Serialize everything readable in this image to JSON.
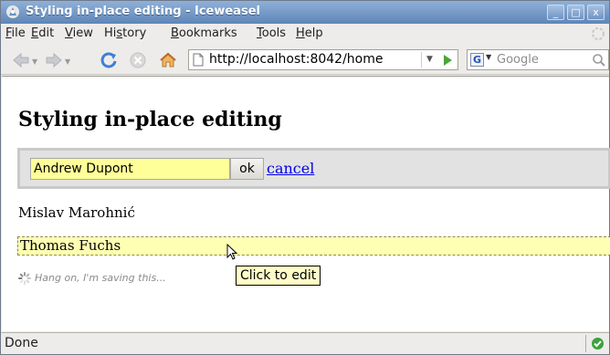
{
  "window": {
    "title": "Styling in-place editing - Iceweasel",
    "controls": {
      "minimize": "_",
      "maximize": "□",
      "close": "x"
    }
  },
  "menu": [
    {
      "accel": "F",
      "rest": "ile"
    },
    {
      "accel": "E",
      "rest": "dit"
    },
    {
      "accel": "V",
      "rest": "iew"
    },
    {
      "pre": "Hi",
      "accel": "s",
      "rest": "tory"
    },
    {
      "accel": "B",
      "rest": "ookmarks"
    },
    {
      "accel": "T",
      "rest": "ools"
    },
    {
      "accel": "H",
      "rest": "elp"
    }
  ],
  "navigation": {
    "url": "http://localhost:8042/home",
    "search_placeholder": "Google",
    "search_engine_letter": "G"
  },
  "page": {
    "heading": "Styling in-place editing",
    "editor": {
      "input_value": "Andrew Dupont",
      "ok_label": "ok",
      "cancel_label": "cancel"
    },
    "static_name": "Mislav Marohnić",
    "editable_name": "Thomas Fuchs",
    "saving_message": "Hang on, I'm saving this...",
    "tooltip": "Click to edit"
  },
  "status": {
    "text": "Done"
  },
  "colors": {
    "titlebar": "#5e86b8",
    "editor_input_bg": "#ffff99",
    "editable_highlight": "#ffffb3",
    "link": "#0000ee",
    "tooltip_bg": "#fffcc8"
  }
}
